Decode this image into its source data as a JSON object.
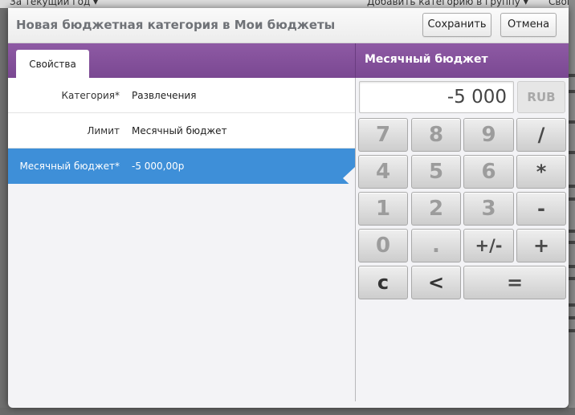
{
  "background": {
    "top_left": "За текущий год ▾",
    "top_mid": "Добавить категорию в группу ▾",
    "top_right": "Свойс"
  },
  "modal": {
    "title": "Новая бюджетная категория в Мои бюджеты",
    "save_label": "Сохранить",
    "cancel_label": "Отмена"
  },
  "tab": {
    "label": "Свойства"
  },
  "form": {
    "rows": [
      {
        "label": "Категория*",
        "value": "Развлечения"
      },
      {
        "label": "Лимит",
        "value": "Месячный бюджет"
      },
      {
        "label": "Месячный бюджет*",
        "value": "-5 000,00р"
      }
    ]
  },
  "calculator": {
    "title": "Месячный бюджет",
    "display": "-5 000",
    "currency": "RUB",
    "keys": {
      "k7": "7",
      "k8": "8",
      "k9": "9",
      "div": "/",
      "k4": "4",
      "k5": "5",
      "k6": "6",
      "mul": "*",
      "k1": "1",
      "k2": "2",
      "k3": "3",
      "sub": "-",
      "k0": "0",
      "dot": ".",
      "neg": "+/-",
      "add": "+",
      "clear": "c",
      "back": "<",
      "eq": "="
    }
  },
  "colors": {
    "accent_purple": "#8e5aa4",
    "selected_row": "#3e8fd8"
  }
}
